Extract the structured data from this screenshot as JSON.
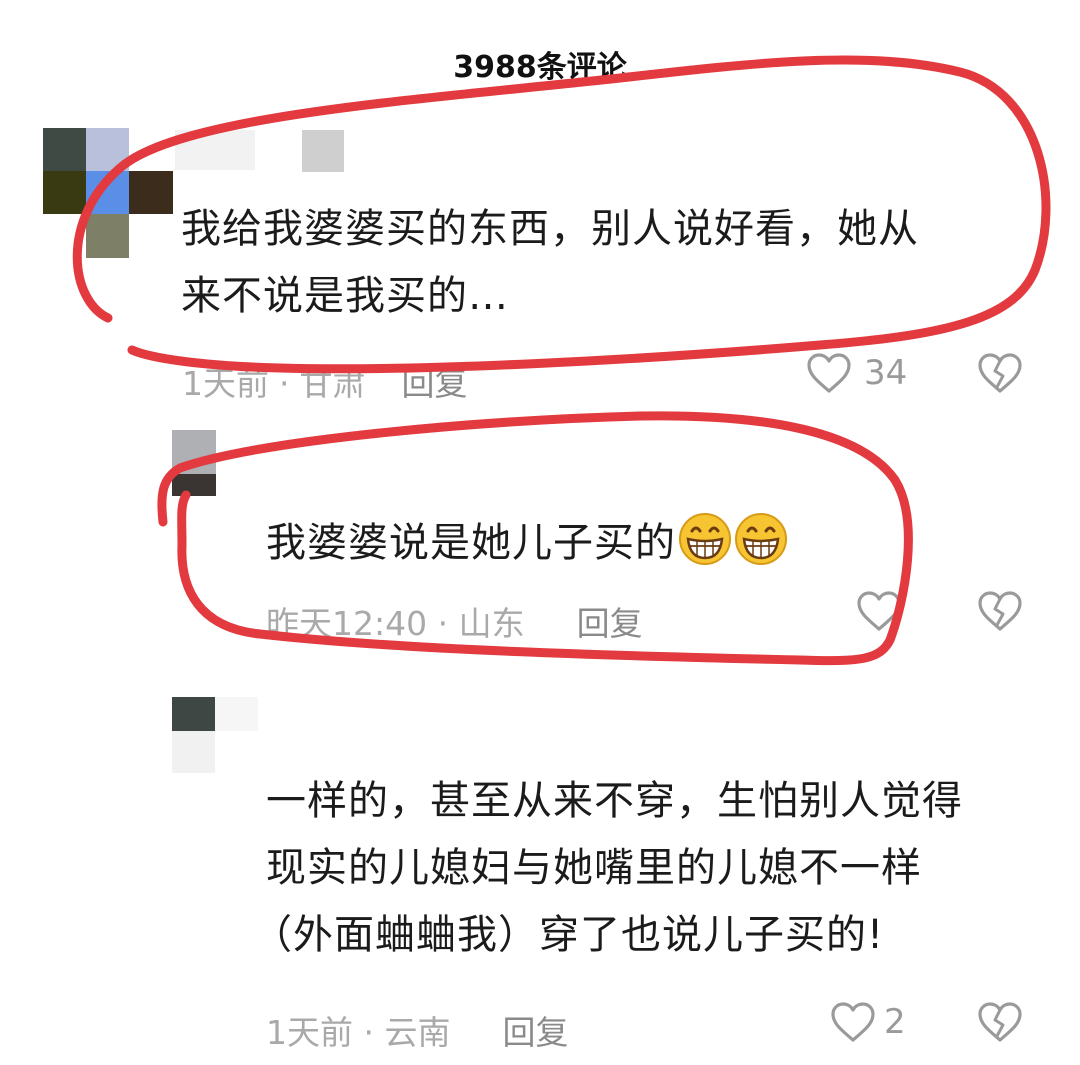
{
  "header": {
    "title": "3988条评论"
  },
  "comments": [
    {
      "text_lines": [
        "我给我婆婆买的东西，别人说好看，她从",
        "来不说是我买的…"
      ],
      "time": "1天前",
      "location": "甘肃",
      "reply_label": "回复",
      "likes": "34",
      "like_icon": "heart-outline-icon",
      "dislike_icon": "broken-heart-icon"
    },
    {
      "text": "我婆婆说是她儿子买的",
      "emojis": [
        "grinning-emoji",
        "grinning-emoji"
      ],
      "meta": "昨天12:40 · 山东",
      "reply_label": "回复",
      "likes": ""
    },
    {
      "text_lines": [
        "一样的，甚至从来不穿，生怕别人觉得",
        "现实的儿媳妇与她嘴里的儿媳不一样",
        "（外面蛐蛐我）穿了也说儿子买的!"
      ],
      "meta": "1天前 · 云南",
      "reply_label": "回复",
      "likes": "2"
    }
  ],
  "colors": {
    "annotation": "#e23a3f",
    "meta_text": "#a9a9a9",
    "icon": "#9a9a9a"
  }
}
